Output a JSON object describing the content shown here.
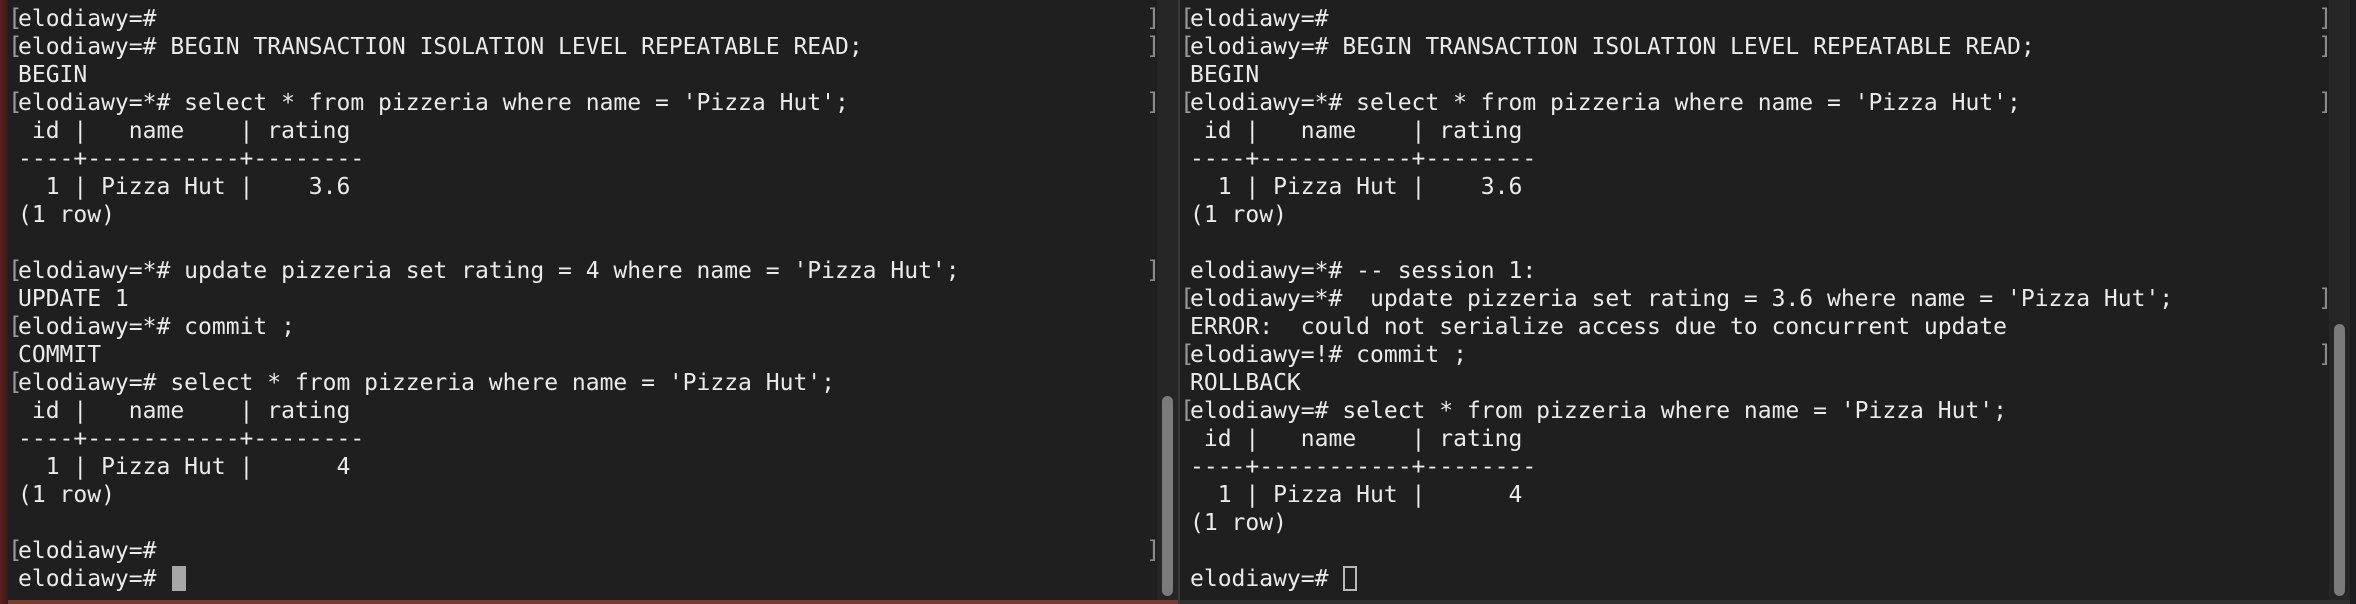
{
  "left_terminal": {
    "lines": [
      "elodiawy=#",
      "elodiawy=# BEGIN TRANSACTION ISOLATION LEVEL REPEATABLE READ;",
      "BEGIN",
      "elodiawy=*# select * from pizzeria where name = 'Pizza Hut';",
      " id |   name    | rating",
      "----+-----------+--------",
      "  1 | Pizza Hut |    3.6",
      "(1 row)",
      "",
      "elodiawy=*# update pizzeria set rating = 4 where name = 'Pizza Hut';",
      "UPDATE 1",
      "elodiawy=*# commit ;",
      "COMMIT",
      "elodiawy=# select * from pizzeria where name = 'Pizza Hut';",
      " id |   name    | rating",
      "----+-----------+--------",
      "  1 | Pizza Hut |      4",
      "(1 row)",
      "",
      "elodiawy=#",
      "elodiawy=# "
    ]
  },
  "right_terminal": {
    "lines": [
      "elodiawy=#",
      "elodiawy=# BEGIN TRANSACTION ISOLATION LEVEL REPEATABLE READ;",
      "BEGIN",
      "elodiawy=*# select * from pizzeria where name = 'Pizza Hut';",
      " id |   name    | rating",
      "----+-----------+--------",
      "  1 | Pizza Hut |    3.6",
      "(1 row)",
      "",
      "elodiawy=*# -- session 1:",
      "elodiawy=*#  update pizzeria set rating = 3.6 where name = 'Pizza Hut';",
      "ERROR:  could not serialize access due to concurrent update",
      "elodiawy=!# commit ;",
      "ROLLBACK",
      "elodiawy=# select * from pizzeria where name = 'Pizza Hut';",
      " id |   name    | rating",
      "----+-----------+--------",
      "  1 | Pizza Hut |      4",
      "(1 row)",
      "",
      "elodiawy=# "
    ]
  }
}
